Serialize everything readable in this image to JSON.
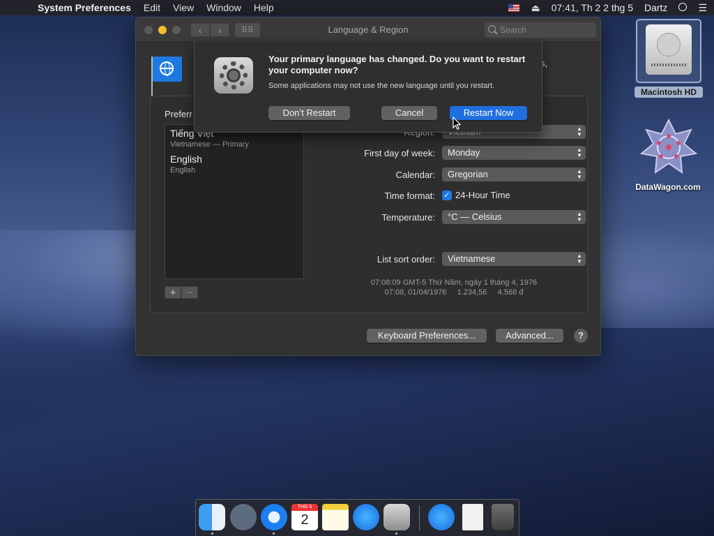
{
  "menubar": {
    "app_name": "System Preferences",
    "menus": [
      "Edit",
      "View",
      "Window",
      "Help"
    ],
    "datetime": "07:41, Th 2 2 thg 5",
    "user": "Dartz"
  },
  "window": {
    "title": "Language & Region",
    "search_placeholder": "Search",
    "truncated_text": "s,",
    "preferred_label": "Preferr",
    "languages": [
      {
        "name": "Tiếng Việt",
        "sub": "Vietnamese — Primary"
      },
      {
        "name": "English",
        "sub": "English"
      }
    ],
    "region_label": "Region:",
    "region_value": "Vietnam",
    "first_day_label": "First day of week:",
    "first_day_value": "Monday",
    "calendar_label": "Calendar:",
    "calendar_value": "Gregorian",
    "time_format_label": "Time format:",
    "time_format_value": "24-Hour Time",
    "temperature_label": "Temperature:",
    "temperature_value": "°C — Celsius",
    "sort_label": "List sort order:",
    "sort_value": "Vietnamese",
    "sample_line1": "07:08:09 GMT-5 Thứ Năm, ngày 1 tháng 4, 1976",
    "sample_line2": "07:08, 01/04/1976     1.234,56     4.568 đ",
    "keyboard_btn": "Keyboard Preferences...",
    "advanced_btn": "Advanced...",
    "help_btn": "?"
  },
  "dialog": {
    "message": "Your primary language has changed. Do you want to restart your computer now?",
    "info": "Some applications may not use the new language until you restart.",
    "dont_restart": "Don’t Restart",
    "cancel": "Cancel",
    "restart_now": "Restart Now"
  },
  "desktop": {
    "hd_label": "Macintosh HD",
    "web_label": "DataWagon.com"
  },
  "dock": {
    "calendar_month": "THG 5",
    "calendar_day": "2",
    "icons": [
      "finder-icon",
      "launchpad-icon",
      "safari-icon",
      "calendar-icon",
      "notes-icon",
      "app-store-icon",
      "system-preferences-icon",
      "app-store-downloads-icon",
      "document-icon",
      "trash-icon"
    ]
  },
  "colors": {
    "accent": "#1f6fe0",
    "window_bg": "#323232"
  }
}
